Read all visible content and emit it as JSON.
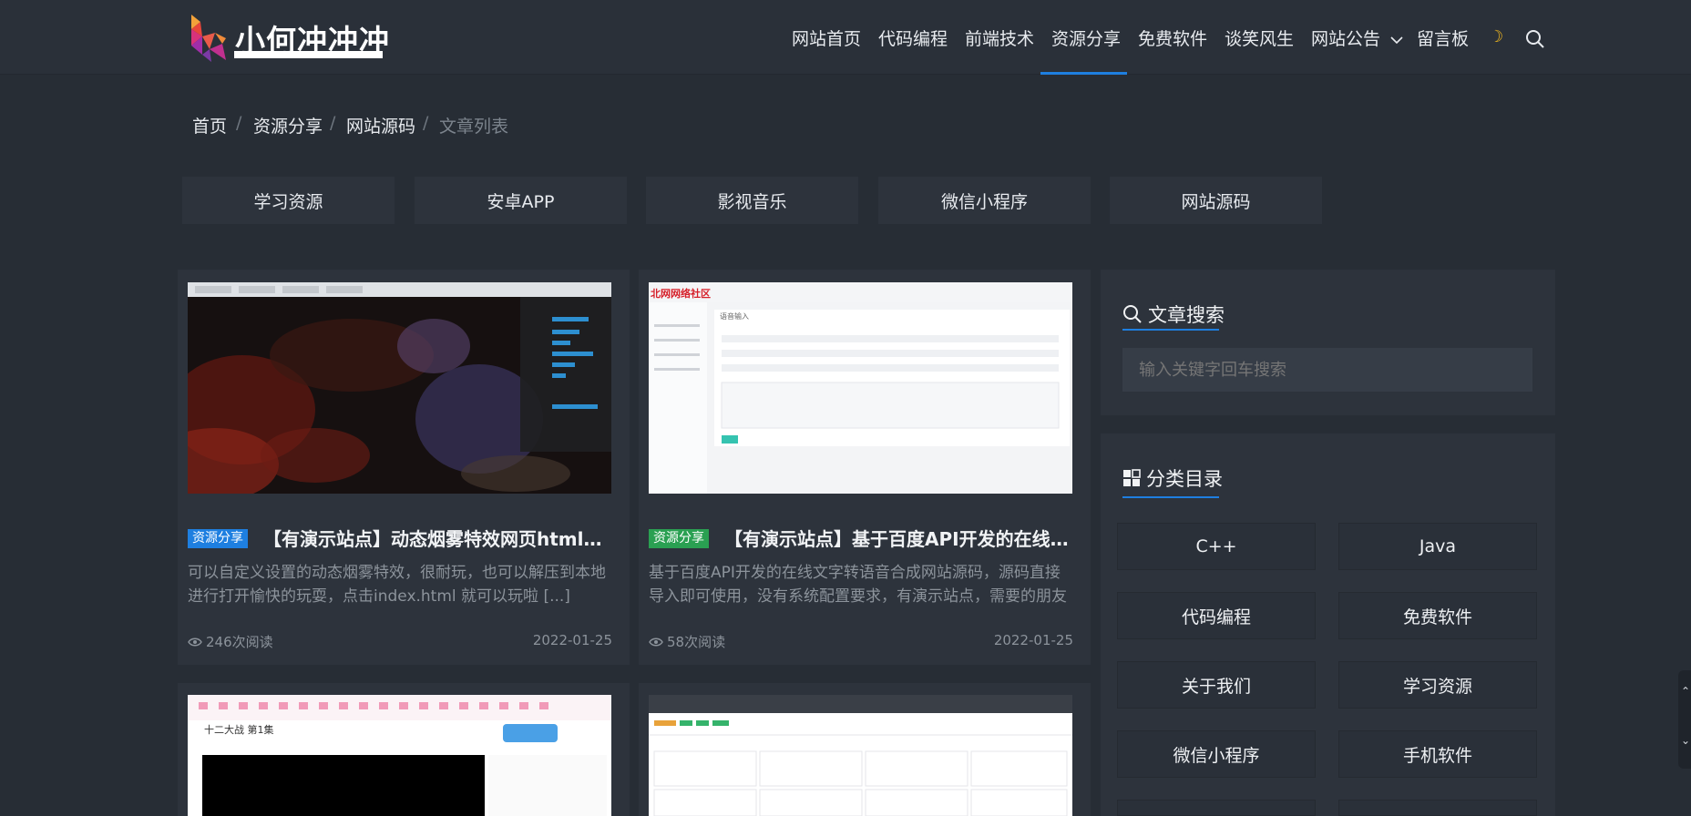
{
  "header": {
    "logo_text": "小何冲冲冲",
    "nav": [
      "网站首页",
      "代码编程",
      "前端技术",
      "资源分享",
      "免费软件",
      "谈笑风生",
      "网站公告",
      "留言板"
    ],
    "active_nav": "资源分享",
    "accent": "#1e7fe0"
  },
  "breadcrumb": {
    "home": "首页",
    "level1": "资源分享",
    "level2": "网站源码",
    "current": "文章列表",
    "sep": "/"
  },
  "categories": [
    "学习资源",
    "安卓APP",
    "影视音乐",
    "微信小程序",
    "网站源码"
  ],
  "posts": [
    {
      "tag": "资源分享",
      "tag_color": "#1e7fe0",
      "title": "【有演示站点】动态烟雾特效网页html汉化版",
      "excerpt": "可以自定义设置的动态烟雾特效，很耐玩，也可以解压到本地进行打开愉快的玩耍，点击index.html 就可以玩啦 [...]",
      "views": "246次阅读",
      "date": "2022-01-25"
    },
    {
      "tag": "资源分享",
      "tag_color": "#2aa052",
      "title": "【有演示站点】基于百度API开发的在线文字转语音合成网站源码",
      "excerpt": "基于百度API开发的在线文字转语音合成网站源码，源码直接导入即可使用，没有系统配置要求，有演示站点，需要的朋友可以下载",
      "views": "58次阅读",
      "date": "2022-01-25"
    }
  ],
  "screenshot_text": {
    "site2_brand": "北网网络社区",
    "site2_heading": "语音输入",
    "video_title": "十二大战 第1集"
  },
  "sidebar": {
    "search_title": "文章搜索",
    "search_placeholder": "输入关键字回车搜索",
    "category_title": "分类目录",
    "categories": [
      "C++",
      "Java",
      "代码编程",
      "免费软件",
      "关于我们",
      "学习资源",
      "微信小程序",
      "手机软件"
    ]
  }
}
